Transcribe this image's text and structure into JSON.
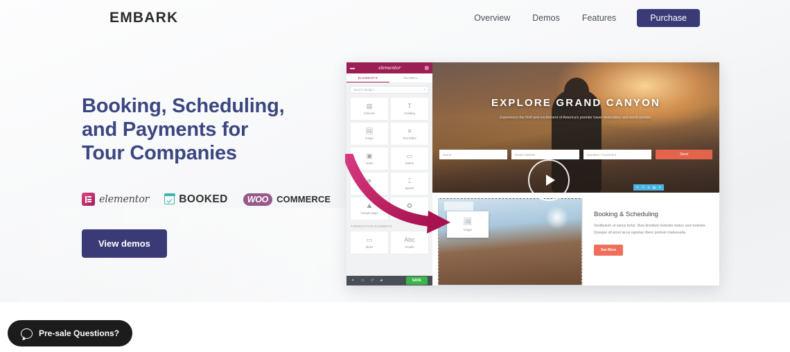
{
  "header": {
    "logo": "EMBARK",
    "nav": [
      {
        "label": "Overview"
      },
      {
        "label": "Demos"
      },
      {
        "label": "Features"
      }
    ],
    "purchase_label": "Purchase",
    "accent_color": "#3a3a77"
  },
  "hero": {
    "headline_lines": [
      "Booking, Scheduling,",
      "and Payments for",
      "Tour Companies"
    ],
    "headline_color": "#3c4680",
    "brands": [
      {
        "name": "elementor",
        "icon": "elementor-icon",
        "color": "#9c1f5e"
      },
      {
        "name": "BOOKED",
        "icon": "calendar-icon",
        "color": "#3fb3ad"
      },
      {
        "name": "WOO",
        "name2": "COMMERCE",
        "icon": "woocommerce-icon",
        "color": "#96588a"
      }
    ],
    "cta_label": "View demos"
  },
  "editor": {
    "panel": {
      "logo": "elementor",
      "menu_icon": "hamburger-icon",
      "grid_icon": "grid-icon",
      "tabs": [
        {
          "label": "ELEMENTS",
          "active": true
        },
        {
          "label": "GLOBAL",
          "active": false
        }
      ],
      "search_placeholder": "Search Widget...",
      "search_icon": "search-icon",
      "widgets": [
        {
          "label": "Columns",
          "icon": "columns-icon",
          "glyph": "▤"
        },
        {
          "label": "Heading",
          "icon": "heading-icon",
          "glyph": "T"
        },
        {
          "label": "Image",
          "icon": "image-icon",
          "glyph": "🖼"
        },
        {
          "label": "Text Editor",
          "icon": "text-editor-icon",
          "glyph": "≡"
        },
        {
          "label": "Video",
          "icon": "video-icon",
          "glyph": "▣"
        },
        {
          "label": "Button",
          "icon": "button-icon",
          "glyph": "▭"
        },
        {
          "label": "Divider",
          "icon": "divider-icon",
          "glyph": "≑"
        },
        {
          "label": "Spacer",
          "icon": "spacer-icon",
          "glyph": "⌶"
        },
        {
          "label": "Google Maps",
          "icon": "google-maps-icon",
          "glyph": "⛰"
        },
        {
          "label": "Icon",
          "icon": "star-icon",
          "glyph": "✪"
        }
      ],
      "section_label": "THEMOVATION ELEMENTS",
      "theme_widgets": [
        {
          "label": "Slider",
          "icon": "slider-icon",
          "glyph": "▭"
        },
        {
          "label": "Header",
          "icon": "header-icon",
          "glyph": "Abc"
        }
      ],
      "footer": {
        "icons": [
          "settings-icon",
          "responsive-icon",
          "history-icon",
          "preview-icon"
        ],
        "save_label": "SAVE",
        "save_color": "#39b54a"
      }
    },
    "preview": {
      "banner_title": "EXPLORE GRAND CANYON",
      "banner_subtitle": "Experience the thrill and excitement of America's premier travel destination and world wonder.",
      "form_fields": [
        {
          "placeholder": "Name"
        },
        {
          "placeholder": "Email Address"
        },
        {
          "placeholder": "Question / Comment"
        }
      ],
      "send_label": "Send",
      "send_color": "#e2644a",
      "play_icon": "play-icon",
      "section_tool_icons": [
        "edit-icon",
        "duplicate-icon",
        "add-icon",
        "save-icon",
        "delete-icon"
      ],
      "drop_widget": {
        "label": "Image",
        "icon": "image-icon",
        "glyph": "🖼"
      },
      "content": {
        "title": "Booking & Scheduling",
        "body": "Vestibulum ut varius tortor. Duis tincidunt molestie metus sed molestie. Quisque sit amet lacus egestas libero pretium malesuada.",
        "button_label": "See More",
        "button_color": "#ef6e5c"
      }
    },
    "arrow_color": "#b8215f"
  },
  "chat_widget": {
    "label": "Pre-sale Questions?",
    "icon": "chat-bubble-icon"
  }
}
